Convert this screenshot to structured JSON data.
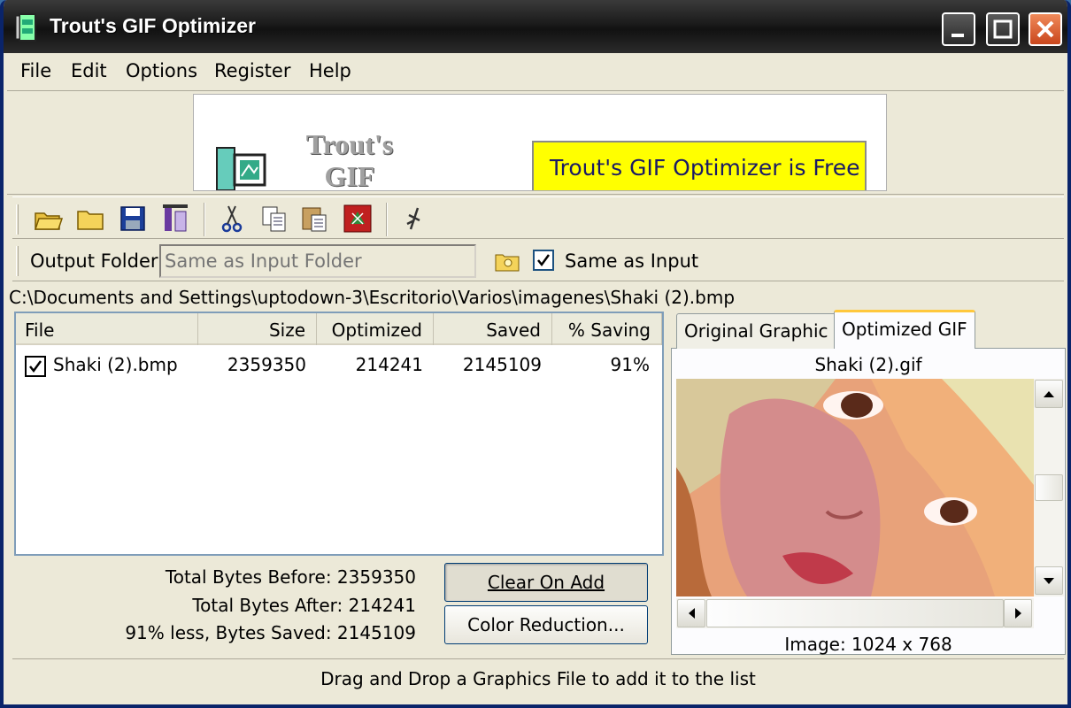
{
  "window": {
    "title": "Trout's GIF Optimizer"
  },
  "menu": [
    "File",
    "Edit",
    "Options",
    "Register",
    "Help"
  ],
  "banner": {
    "title_line1": "Trout's",
    "title_line2": "GIF",
    "promo": "Trout's GIF Optimizer is Free"
  },
  "toolbar": {
    "icons": [
      "open-folder-icon",
      "new-folder-icon",
      "save-icon",
      "compress-icon",
      "cut-icon",
      "copy-icon",
      "paste-icon",
      "optimize-icon",
      "help-link-icon"
    ]
  },
  "output": {
    "label": "Output Folder",
    "placeholder": "Same as Input Folder",
    "same_label": "Same as Input",
    "same_checked": true
  },
  "path": "C:\\Documents and Settings\\uptodown-3\\Escritorio\\Varios\\imagenes\\Shaki (2).bmp",
  "list": {
    "columns": [
      "File",
      "Size",
      "Optimized",
      "Saved",
      "% Saving"
    ],
    "rows": [
      {
        "checked": true,
        "file": "Shaki (2).bmp",
        "size": "2359350",
        "optimized": "214241",
        "saved": "2145109",
        "saving": "91%"
      }
    ]
  },
  "totals": {
    "before": "Total Bytes Before: 2359350",
    "after": "Total Bytes After: 214241",
    "saved": "91% less, Bytes Saved: 2145109"
  },
  "buttons": {
    "clear_on_add": "Clear On Add",
    "color_reduction": "Color Reduction..."
  },
  "tabs": [
    "Original Graphic",
    "Optimized GIF"
  ],
  "preview": {
    "file_name": "Shaki (2).gif",
    "image_size": "Image: 1024 x 768"
  },
  "status": "Drag and Drop a Graphics File to add it to the list",
  "colors": {
    "titlebar": "#1b1b1b",
    "face": "#ece9d8",
    "promo_bg": "#ffff00",
    "close": "#c9461c"
  }
}
